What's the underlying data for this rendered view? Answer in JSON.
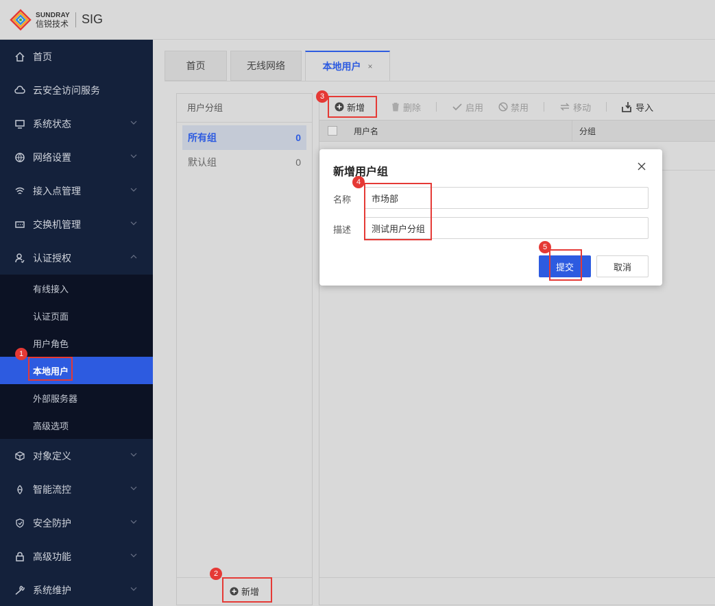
{
  "header": {
    "brand_en": "SUNDRAY",
    "brand_cn": "信锐技术",
    "product": "SIG"
  },
  "sidebar": {
    "items": [
      {
        "label": "首页",
        "icon": "home-icon"
      },
      {
        "label": "云安全访问服务",
        "icon": "cloud-lock-icon"
      },
      {
        "label": "系统状态",
        "icon": "monitor-icon"
      },
      {
        "label": "网络设置",
        "icon": "globe-icon"
      },
      {
        "label": "接入点管理",
        "icon": "wifi-icon"
      },
      {
        "label": "交换机管理",
        "icon": "switch-icon"
      },
      {
        "label": "认证授权",
        "icon": "user-auth-icon"
      }
    ],
    "auth_subitems": [
      "有线接入",
      "认证页面",
      "用户角色",
      "本地用户",
      "外部服务器",
      "高级选项"
    ],
    "lower_items": [
      {
        "label": "对象定义",
        "icon": "cube-icon"
      },
      {
        "label": "智能流控",
        "icon": "flow-icon"
      },
      {
        "label": "安全防护",
        "icon": "shield-icon"
      },
      {
        "label": "高级功能",
        "icon": "lock-icon"
      },
      {
        "label": "系统维护",
        "icon": "wrench-icon"
      }
    ]
  },
  "tabs": [
    {
      "label": "首页"
    },
    {
      "label": "无线网络"
    },
    {
      "label": "本地用户",
      "close": "×"
    }
  ],
  "groups": {
    "title": "用户分组",
    "rows": [
      {
        "name": "所有组",
        "count": "0"
      },
      {
        "name": "默认组",
        "count": "0"
      }
    ],
    "add_label": "新增"
  },
  "toolbar": {
    "add": "新增",
    "delete": "删除",
    "enable": "启用",
    "disable": "禁用",
    "move": "移动",
    "import": "导入"
  },
  "table": {
    "columns": [
      "用户名",
      "分组"
    ]
  },
  "dialog": {
    "title": "新增用户组",
    "name_label": "名称",
    "name_value": "市场部",
    "desc_label": "描述",
    "desc_value": "测试用户分组",
    "submit": "提交",
    "cancel": "取消"
  },
  "annotations": [
    "1",
    "2",
    "3",
    "4",
    "5"
  ],
  "colors": {
    "accent": "#2d5be0",
    "sidebar_bg": "#14213b",
    "annotation": "#e53935"
  }
}
